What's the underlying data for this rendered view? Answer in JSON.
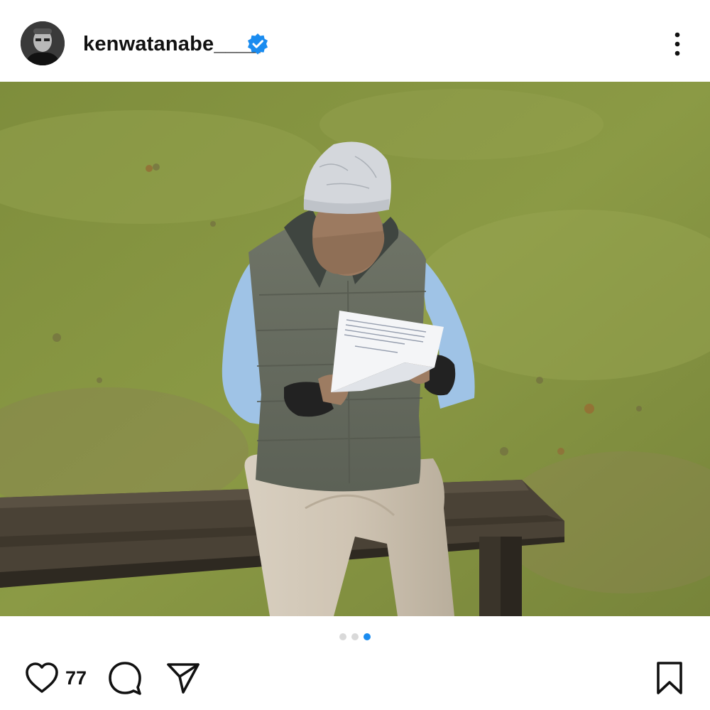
{
  "post": {
    "username": "kenwatanabe____",
    "verified": true,
    "likes": "77",
    "carousel": {
      "total": 3,
      "active_index": 2
    }
  },
  "icons": {
    "avatar": "profile-photo",
    "verified": "verified-badge-icon",
    "more": "more-vertical-icon",
    "like": "heart-icon",
    "comment": "comment-bubble-icon",
    "share": "paper-plane-icon",
    "save": "bookmark-icon"
  },
  "colors": {
    "verified_blue": "#1a8cf0",
    "active_dot": "#1a8cf0",
    "inactive_dot": "#d9d9d9"
  }
}
